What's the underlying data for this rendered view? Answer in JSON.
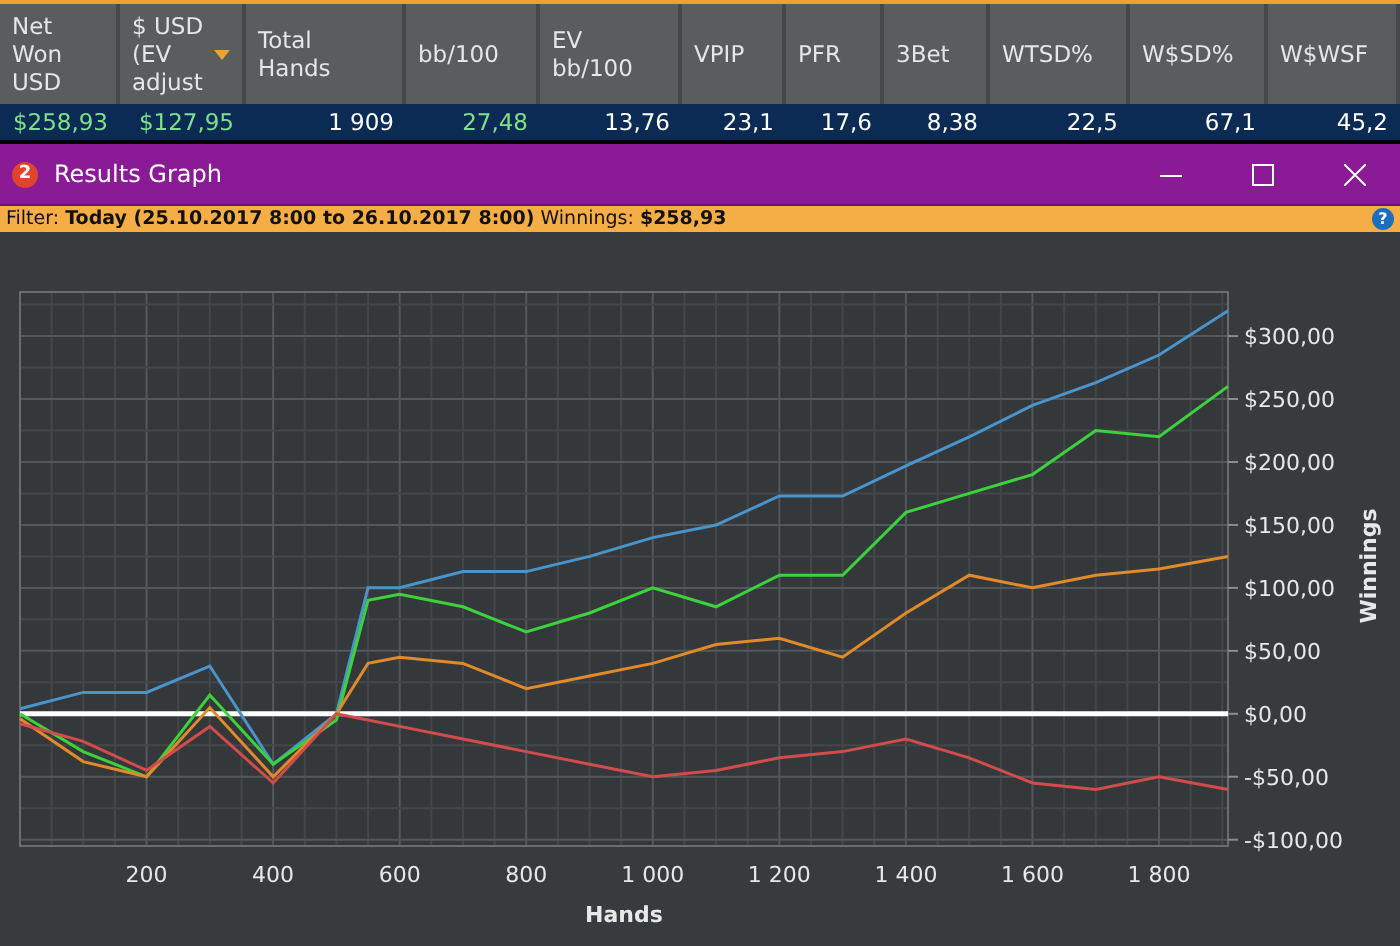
{
  "stats_table": {
    "columns": [
      {
        "label": "Net Won USD",
        "sorted": false
      },
      {
        "label": "$ USD (EV adjust",
        "sorted": true
      },
      {
        "label": "Total Hands",
        "sorted": false
      },
      {
        "label": "bb/100",
        "sorted": false
      },
      {
        "label": "EV bb/100",
        "sorted": false
      },
      {
        "label": "VPIP",
        "sorted": false
      },
      {
        "label": "PFR",
        "sorted": false
      },
      {
        "label": "3Bet",
        "sorted": false
      },
      {
        "label": "WTSD%",
        "sorted": false
      },
      {
        "label": "W$SD%",
        "sorted": false
      },
      {
        "label": "W$WSF",
        "sorted": false
      }
    ],
    "row": [
      {
        "text": "$258,93",
        "color": "#7ee08a"
      },
      {
        "text": "$127,95",
        "color": "#7ee08a"
      },
      {
        "text": "1 909",
        "color": "#ffffff"
      },
      {
        "text": "27,48",
        "color": "#7ee08a"
      },
      {
        "text": "13,76",
        "color": "#ffffff"
      },
      {
        "text": "23,1",
        "color": "#ffffff"
      },
      {
        "text": "17,6",
        "color": "#ffffff"
      },
      {
        "text": "8,38",
        "color": "#ffffff"
      },
      {
        "text": "22,5",
        "color": "#ffffff"
      },
      {
        "text": "67,1",
        "color": "#ffffff"
      },
      {
        "text": "45,2",
        "color": "#ffffff"
      }
    ]
  },
  "window": {
    "badge": "2",
    "title": "Results Graph"
  },
  "filter_bar": {
    "text": "Filter: **Today (25.10.2017 8:00 to 26.10.2017 8:00)** Winnings: **$258,93**",
    "help": "?"
  },
  "chart": {
    "chart_data": {
      "type": "line",
      "grid": true,
      "xlabel": "Hands",
      "ylabel": "Winnings",
      "x": [
        0,
        100,
        200,
        300,
        400,
        500,
        550,
        600,
        700,
        800,
        900,
        1000,
        1100,
        1200,
        1300,
        1400,
        1500,
        1600,
        1700,
        1800,
        1909
      ],
      "series": [
        {
          "color": "#4a94cc",
          "values": [
            4,
            17,
            17,
            38,
            -40,
            0,
            100,
            100,
            113,
            113,
            125,
            140,
            150,
            173,
            173,
            197,
            220,
            245,
            263,
            285,
            320
          ]
        },
        {
          "color": "#3cd23c",
          "values": [
            0,
            -30,
            -50,
            15,
            -40,
            -5,
            90,
            95,
            85,
            65,
            80,
            100,
            85,
            110,
            110,
            160,
            175,
            190,
            225,
            220,
            260
          ]
        },
        {
          "color": "#e08a2a",
          "values": [
            -4,
            -38,
            -50,
            5,
            -50,
            0,
            40,
            45,
            40,
            20,
            30,
            40,
            55,
            60,
            45,
            80,
            110,
            100,
            110,
            115,
            125
          ]
        },
        {
          "color": "#d24c4c",
          "values": [
            -8,
            -22,
            -45,
            -10,
            -55,
            0,
            -5,
            -10,
            -20,
            -30,
            -40,
            -50,
            -45,
            -35,
            -30,
            -20,
            -35,
            -55,
            -60,
            -50,
            -60
          ]
        }
      ],
      "xlim": [
        0,
        1909
      ],
      "ylim": [
        -105,
        335
      ],
      "xticks": [
        {
          "value": 200,
          "label": "200"
        },
        {
          "value": 400,
          "label": "400"
        },
        {
          "value": 600,
          "label": "600"
        },
        {
          "value": 800,
          "label": "800"
        },
        {
          "value": 1000,
          "label": "1 000"
        },
        {
          "value": 1200,
          "label": "1 200"
        },
        {
          "value": 1400,
          "label": "1 400"
        },
        {
          "value": 1600,
          "label": "1 600"
        },
        {
          "value": 1800,
          "label": "1 800"
        }
      ],
      "yticks": [
        {
          "value": 300,
          "label": "$300,00"
        },
        {
          "value": 250,
          "label": "$250,00"
        },
        {
          "value": 200,
          "label": "$200,00"
        },
        {
          "value": 150,
          "label": "$150,00"
        },
        {
          "value": 100,
          "label": "$100,00"
        },
        {
          "value": 50,
          "label": "$50,00"
        },
        {
          "value": 0,
          "label": "$0,00"
        },
        {
          "value": -50,
          "label": "-$50,00"
        },
        {
          "value": -100,
          "label": "-$100,00"
        }
      ]
    }
  }
}
